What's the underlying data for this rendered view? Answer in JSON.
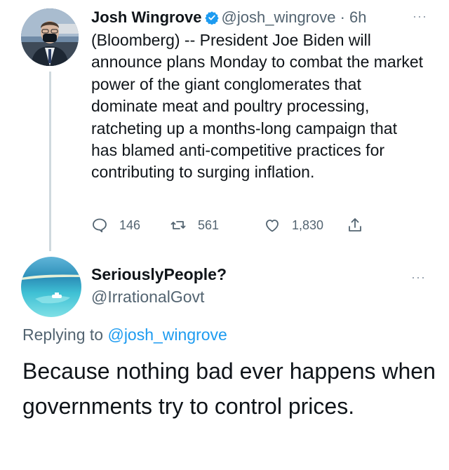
{
  "tweet1": {
    "author_name": "Josh Wingrove",
    "handle": "@josh_wingrove",
    "separator": " · ",
    "time": "6h",
    "more_label": "···",
    "body": "(Bloomberg) -- President Joe Biden will announce plans Monday to combat the market power of the giant conglomerates that dominate meat and poultry processing, ratcheting up a months-long campaign that has blamed anti-competitive practices for contributing to surging inflation.",
    "replies": "146",
    "retweets": "561",
    "likes": "1,830",
    "icons": [
      "reply-icon",
      "retweet-icon",
      "like-icon",
      "share-icon",
      "verified-badge-icon"
    ]
  },
  "tweet2": {
    "author_name": "SeriouslyPeople?",
    "handle": "@IrrationalGovt",
    "more_label": "···",
    "replying_prefix": "Replying to ",
    "replying_to": "@josh_wingrove",
    "body": "Because nothing bad ever happens when governments try to control prices."
  },
  "colors": {
    "text": "#0f1419",
    "muted": "#536471",
    "link": "#1d9bf0",
    "verified": "#1d9bf0",
    "thread_line": "#cfd9de"
  }
}
